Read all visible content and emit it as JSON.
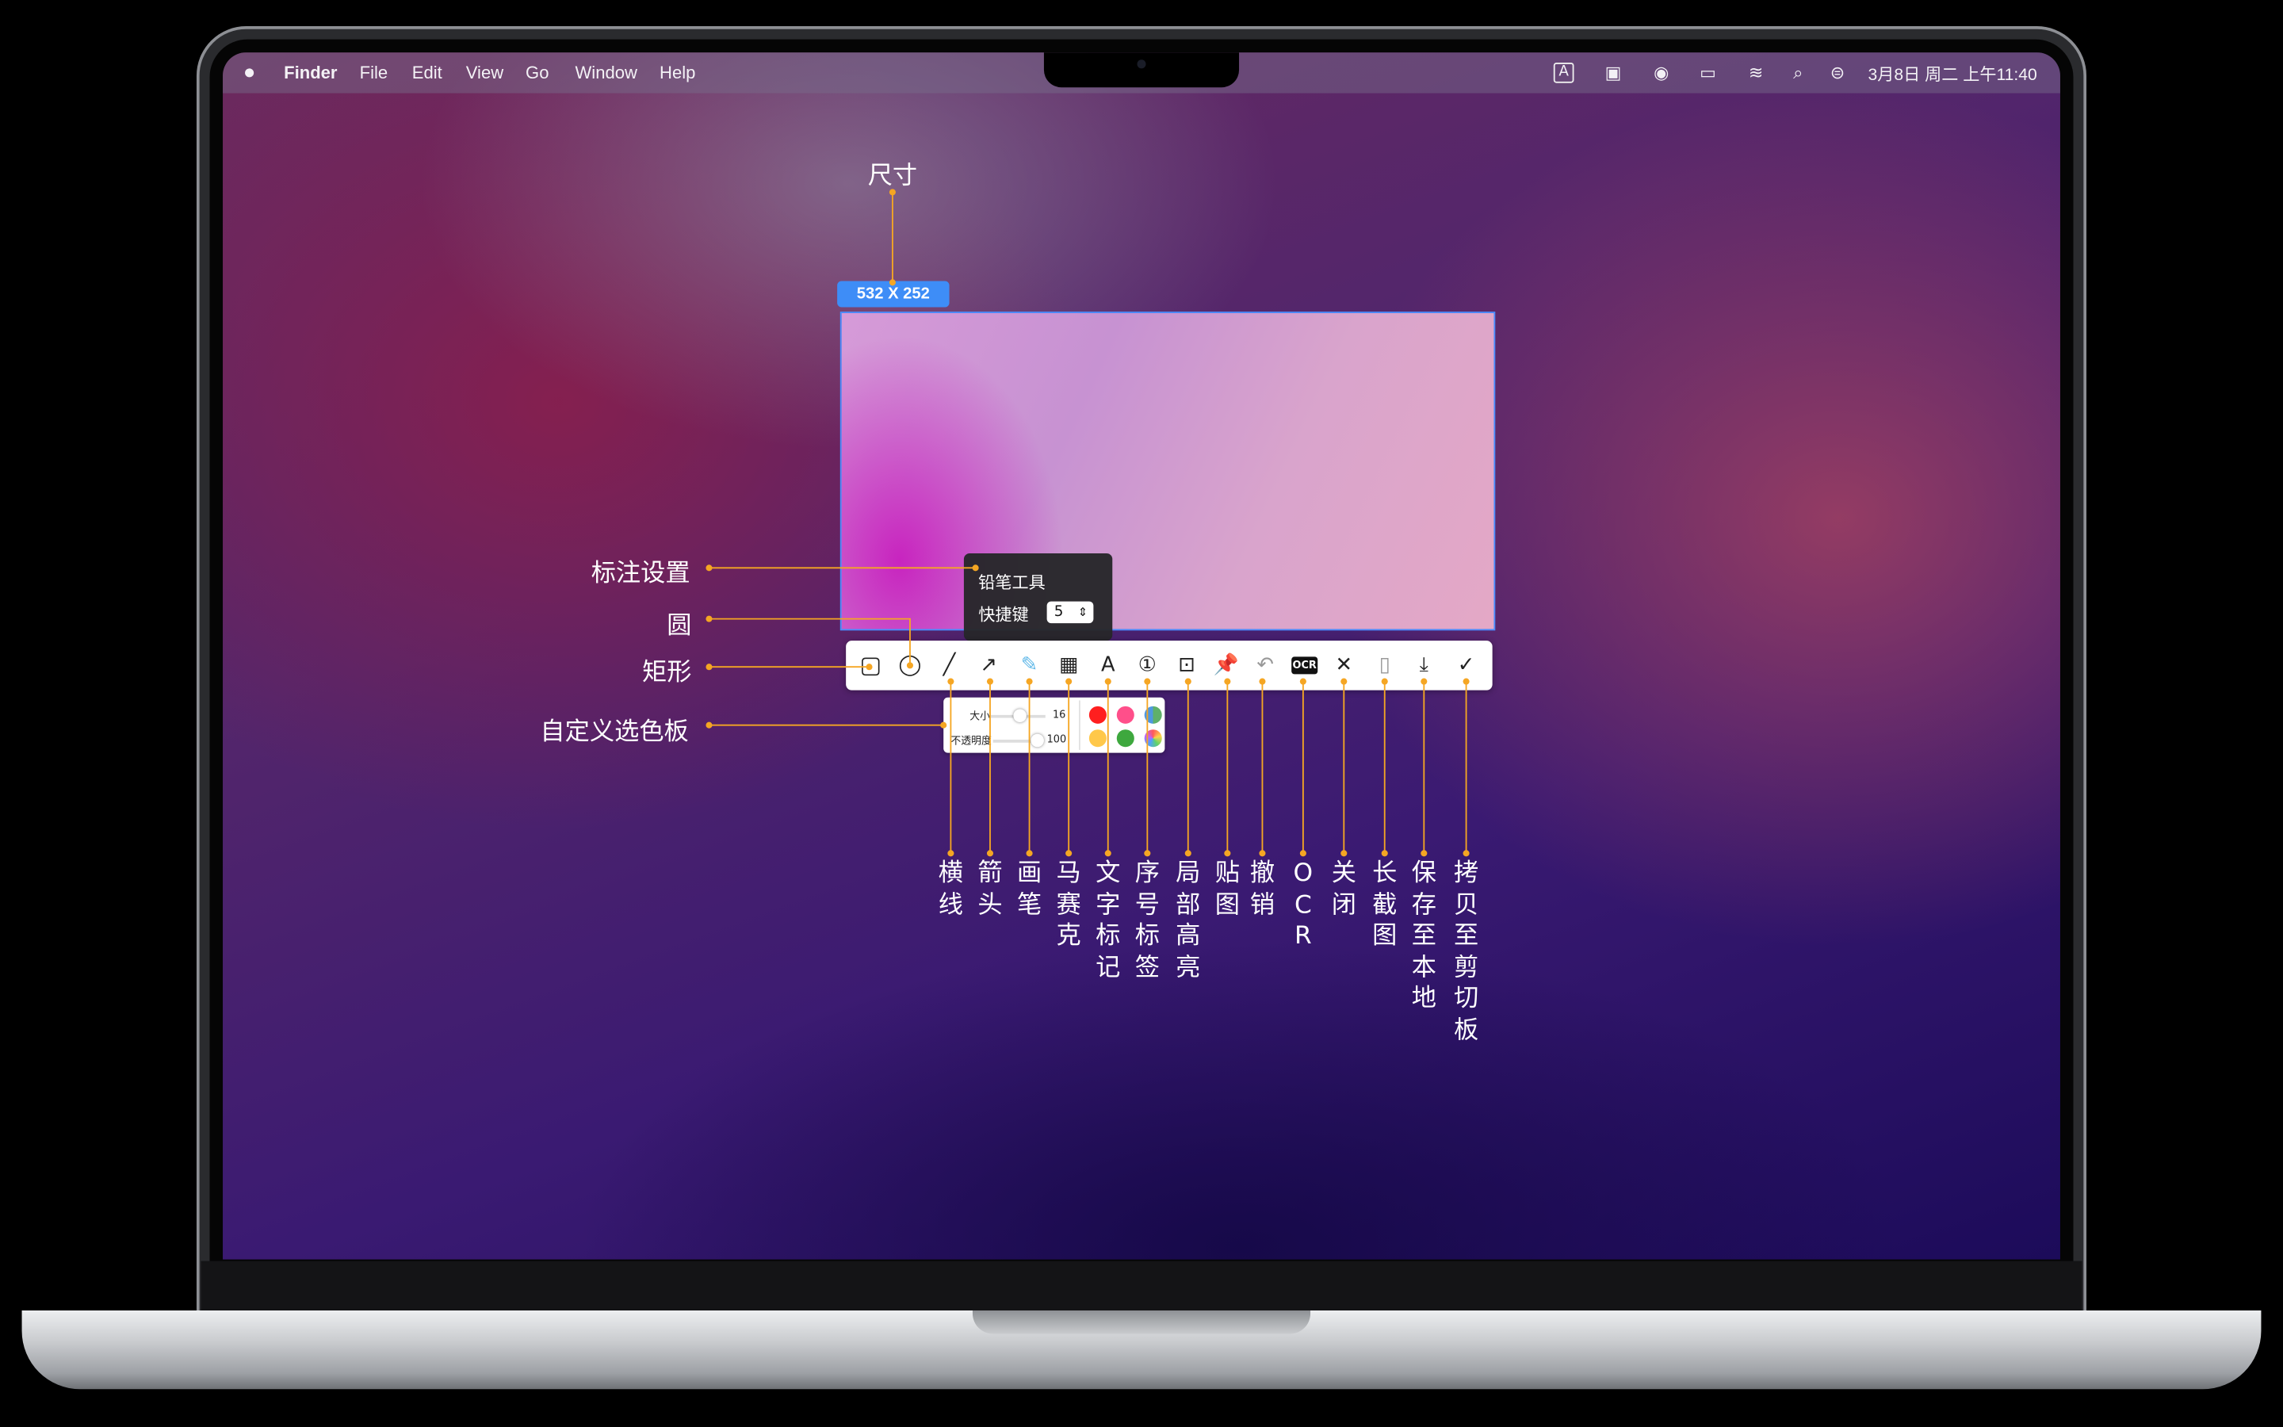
{
  "menubar": {
    "app": "Finder",
    "menus": [
      "File",
      "Edit",
      "View",
      "Go",
      "Window",
      "Help"
    ],
    "clock": "3月8日 周二 上午11:40",
    "status_icons": [
      "text-recognition-icon",
      "image-icon",
      "user-icon",
      "battery-icon",
      "wifi-icon",
      "search-icon",
      "control-center-icon"
    ]
  },
  "selection": {
    "size_label": "532  X  252"
  },
  "tooltip": {
    "title": "铅笔工具",
    "shortcut_label": "快捷键",
    "shortcut_value": "5"
  },
  "toolbar": {
    "tools": [
      {
        "name": "rectangle-tool",
        "glyph": "▢"
      },
      {
        "name": "ellipse-tool",
        "glyph": "◯"
      },
      {
        "name": "line-tool",
        "glyph": "╱"
      },
      {
        "name": "arrow-tool",
        "glyph": "↗"
      },
      {
        "name": "pencil-tool",
        "glyph": "✎"
      },
      {
        "name": "mosaic-tool",
        "glyph": "▦"
      },
      {
        "name": "text-tool",
        "glyph": "A"
      },
      {
        "name": "number-tool",
        "glyph": "①"
      },
      {
        "name": "highlight-tool",
        "glyph": "⊡"
      },
      {
        "name": "pin-tool",
        "glyph": "📌"
      },
      {
        "name": "undo-tool",
        "glyph": "↶"
      },
      {
        "name": "ocr-tool",
        "glyph": "OCR"
      },
      {
        "name": "close-tool",
        "glyph": "✕"
      },
      {
        "name": "long-screenshot-tool",
        "glyph": "▯"
      },
      {
        "name": "save-tool",
        "glyph": "⤓"
      },
      {
        "name": "copy-tool",
        "glyph": "✓"
      }
    ]
  },
  "palette": {
    "size_label": "大小",
    "size_value": "16",
    "opacity_label": "不透明度",
    "opacity_value": "100",
    "size_fraction": 0.3,
    "opacity_fraction": 1.0,
    "colors": [
      "#ff1f1f",
      "#ff4f8a",
      "#4f98e0",
      "#ffc84a",
      "#3ea83e",
      "#6ab0ff"
    ]
  },
  "callouts": {
    "size": "尺寸",
    "annotation_settings": "标注设置",
    "circle": "圆",
    "rectangle": "矩形",
    "palette": "自定义选色板"
  },
  "tool_labels": [
    "横线",
    "箭头",
    "画笔",
    "马赛克",
    "文字标记",
    "序号标签",
    "局部高亮",
    "贴图",
    "撤销",
    "OCR",
    "关闭",
    "长截图",
    "保存至本地",
    "拷贝至剪切板"
  ],
  "colors": {
    "accent": "#f5a623",
    "selection": "#4a8dff"
  }
}
